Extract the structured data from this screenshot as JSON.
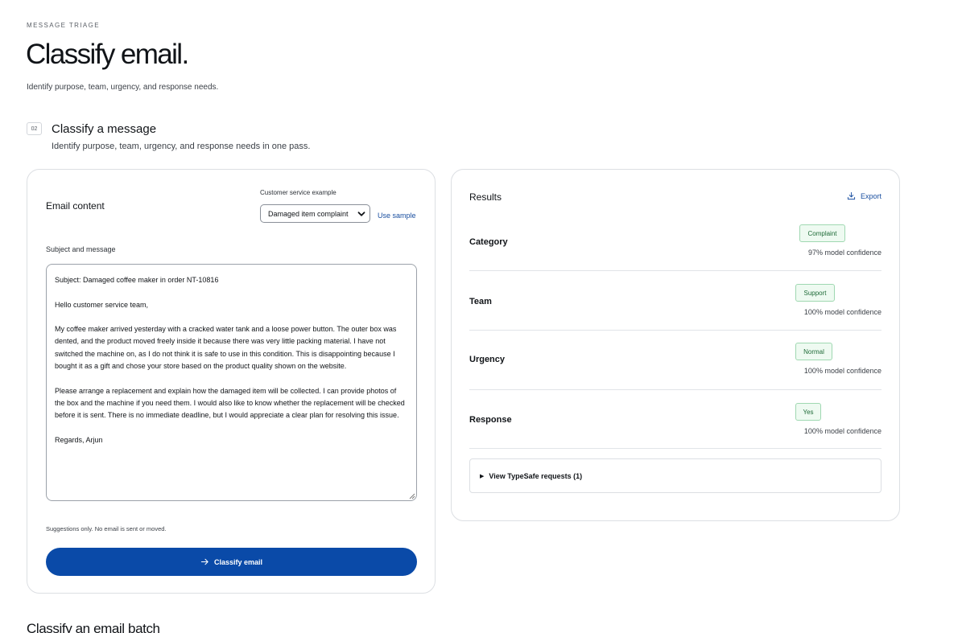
{
  "header": {
    "eyebrow": "MESSAGE TRIAGE",
    "title": "Classify email.",
    "subtitle": "Identify purpose, team, urgency, and response needs."
  },
  "section": {
    "step": "02",
    "title": "Classify a message",
    "subtitle": "Identify purpose, team, urgency, and response needs in one pass."
  },
  "email_card": {
    "heading": "Email content",
    "example_label": "Customer service example",
    "example_selected": "Damaged item complaint",
    "use_sample": "Use sample",
    "field_label": "Subject and message",
    "message": {
      "subject": "Subject: Damaged coffee maker in order NT-10816",
      "greeting": "Hello customer service team,",
      "para1": "My coffee maker arrived yesterday with a cracked water tank and a loose power button. The outer box was dented, and the product moved freely inside it because there was very little packing material. I have not switched the machine on, as I do not think it is safe to use in this condition. This is disappointing because I bought it as a gift and chose your store based on the product quality shown on the website.",
      "para2": "Please arrange a replacement and explain how the damaged item will be collected. I can provide photos of the box and the machine if you need them. I would also like to know whether the replacement will be checked before it is sent. There is no immediate deadline, but I would appreciate a clear plan for resolving this issue.",
      "signoff": "Regards, Arjun"
    },
    "note": "Suggestions only. No email is sent or moved.",
    "button": "Classify email"
  },
  "results": {
    "heading": "Results",
    "export": "Export",
    "rows": [
      {
        "label": "Category",
        "badge": "Complaint",
        "confidence": "97% model confidence"
      },
      {
        "label": "Team",
        "badge": "Support",
        "confidence": "100% model confidence"
      },
      {
        "label": "Urgency",
        "badge": "Normal",
        "confidence": "100% model confidence"
      },
      {
        "label": "Response",
        "badge": "Yes",
        "confidence": "100% model confidence"
      }
    ],
    "details": "View TypeSafe requests (1)",
    "details_marker": "▶"
  },
  "batch": {
    "title": "Classify an email batch"
  },
  "colors": {
    "primary": "#0a4aa8",
    "link": "#1a4fa0",
    "badge_bg": "#eefaf1",
    "badge_border": "#9fd8b1",
    "badge_text": "#1f6b38"
  },
  "icons": {
    "export": "download-icon",
    "button": "arrow-right-icon",
    "select": "chevron-down-icon"
  }
}
